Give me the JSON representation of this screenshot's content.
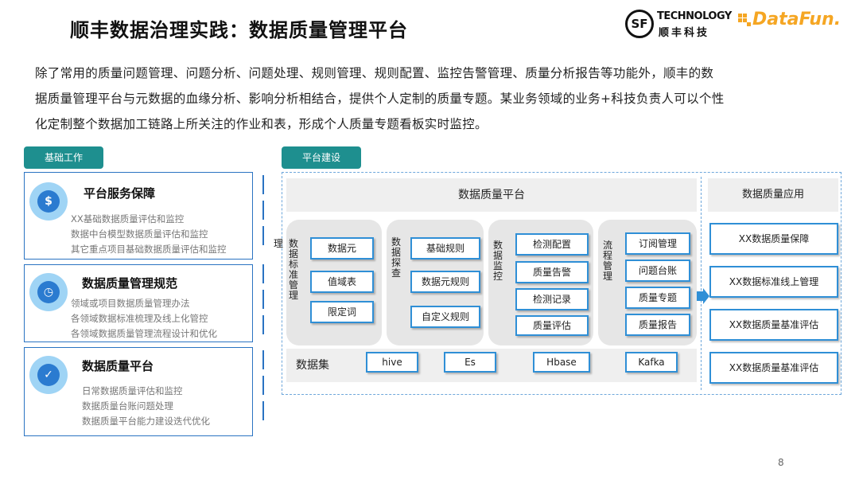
{
  "title": "顺丰数据治理实践：数据质量管理平台",
  "logos": {
    "sf_mark": "SF",
    "sf_technology": "TECHNOLOGY",
    "sf_chinese": "顺丰科技",
    "datafun": "DataFun."
  },
  "intro": [
    "除了常用的质量问题管理、问题分析、问题处理、规则管理、规则配置、监控告警管理、质量分析报告等功能外，顺丰的数",
    "据质量管理平台与元数据的血缘分析、影响分析相结合，提供个人定制的质量专题。某业务领域的业务+科技负责人可以个性",
    "化定制整个数据加工链路上所关注的作业和表，形成个人质量专题看板实时监控。"
  ],
  "left_pill": "基础工作",
  "right_pill": "平台建设",
  "left_sections": [
    {
      "title": "平台服务保障",
      "icon": "money-icon",
      "lines": [
        "XX基础数据质量评估和监控",
        "数据中台模型数据质量评估和监控",
        "其它重点项目基础数据质量评估和监控"
      ]
    },
    {
      "title": "数据质量管理规范",
      "icon": "tag-clock-icon",
      "lines": [
        "领域或项目数据质量管理办法",
        "各领域数据标准梳理及线上化管控",
        "各领域数据质量管理流程设计和优化"
      ]
    },
    {
      "title": "数据质量平台",
      "icon": "user-check-icon",
      "lines": [
        "日常数据质量评估和监控",
        "数据质量台账问题处理",
        "数据质量平台能力建设迭代优化"
      ]
    }
  ],
  "platform": {
    "header": "数据质量平台",
    "columns": [
      {
        "label": "数据标准管理",
        "items": [
          "数据元",
          "值域表",
          "限定词"
        ]
      },
      {
        "label": "数据探查",
        "items": [
          "基础规则",
          "数据元规则",
          "自定义规则"
        ]
      },
      {
        "label": "数据监控",
        "items": [
          "检测配置",
          "质量告警",
          "检测记录",
          "质量评估"
        ]
      },
      {
        "label": "流程管理",
        "items": [
          "订阅管理",
          "问题台账",
          "质量专题",
          "质量报告"
        ]
      }
    ],
    "extra_char": "理",
    "dataset_label": "数据集",
    "datasets": [
      "hive",
      "Es",
      "Hbase",
      "Kafka"
    ]
  },
  "application": {
    "header": "数据质量应用",
    "items": [
      "XX数据质量保障",
      "XX数据标准线上管理",
      "XX数据质量基准评估",
      "XX数据质量基准评估"
    ]
  },
  "page_number": "8",
  "colors": {
    "accent_teal": "#1e8f8f",
    "box_border": "#2f8fd6",
    "icon_blue": "#2b7bd0"
  }
}
